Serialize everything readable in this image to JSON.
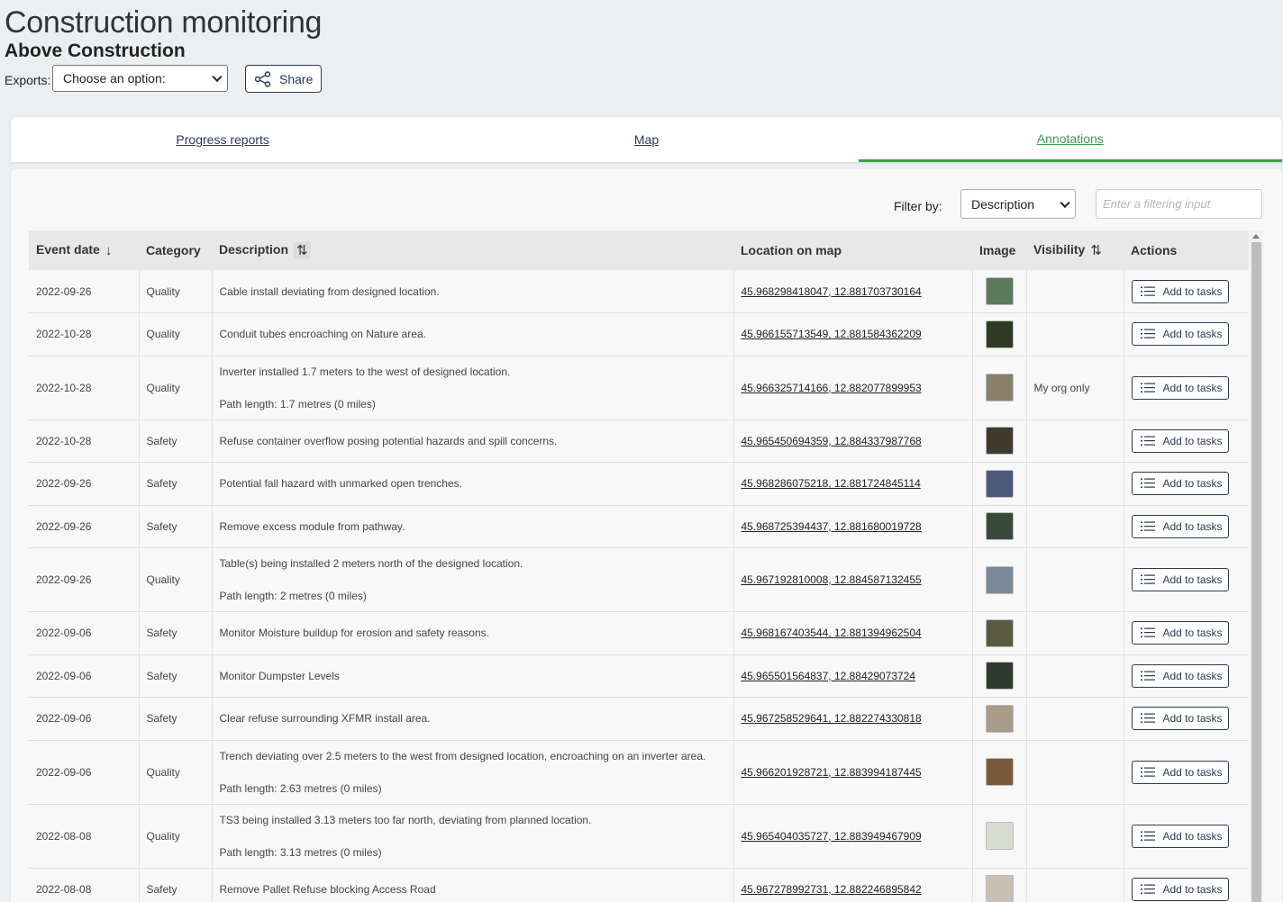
{
  "header": {
    "app_title": "Construction monitoring",
    "project_title": "Above Construction",
    "exports_label": "Exports:",
    "exports_selected": "Choose an option:",
    "share_label": "Share"
  },
  "tabs": [
    {
      "label": "Progress reports",
      "active": false
    },
    {
      "label": "Map",
      "active": false
    },
    {
      "label": "Annotations",
      "active": true
    }
  ],
  "filter": {
    "label": "Filter by:",
    "selected": "Description",
    "placeholder": "Enter a filtering input"
  },
  "table": {
    "columns": [
      "Event date",
      "Category",
      "Description",
      "Location on map",
      "Image",
      "Visibility",
      "Actions"
    ],
    "action_label": "Add to tasks",
    "rows": [
      {
        "date": "2022-09-26",
        "category": "Quality",
        "description": "Cable install deviating from designed location.",
        "path": "",
        "location": "45.968298418047, 12.881703730164",
        "visibility": "",
        "thumb_color": "#5a7a5a"
      },
      {
        "date": "2022-10-28",
        "category": "Quality",
        "description": "Conduit tubes encroaching on Nature area.",
        "path": "",
        "location": "45.966155713549, 12.881584362209",
        "visibility": "",
        "thumb_color": "#2e3a22"
      },
      {
        "date": "2022-10-28",
        "category": "Quality",
        "description": "Inverter installed 1.7 meters to the west of designed location.",
        "path": "Path length: 1.7 metres (0 miles)",
        "location": "45.966325714166, 12.882077899953",
        "visibility": "My org only",
        "thumb_color": "#8a7f6a"
      },
      {
        "date": "2022-10-28",
        "category": "Safety",
        "description": "Refuse container overflow posing potential hazards and spill concerns.",
        "path": "",
        "location": "45.965450694359, 12.884337987768",
        "visibility": "",
        "thumb_color": "#3e3a2c"
      },
      {
        "date": "2022-09-26",
        "category": "Safety",
        "description": "Potential fall hazard with unmarked open trenches.",
        "path": "",
        "location": "45.968286075218, 12.881724845114",
        "visibility": "",
        "thumb_color": "#4a5a7a"
      },
      {
        "date": "2022-09-26",
        "category": "Safety",
        "description": "Remove excess module from pathway.",
        "path": "",
        "location": "45.968725394437, 12.881680019728",
        "visibility": "",
        "thumb_color": "#3a4a3a"
      },
      {
        "date": "2022-09-26",
        "category": "Quality",
        "description": "Table(s) being installed 2 meters north of the designed location.",
        "path": "Path length: 2 metres (0 miles)",
        "location": "45.967192810008, 12.884587132455",
        "visibility": "",
        "thumb_color": "#7a8a9a"
      },
      {
        "date": "2022-09-06",
        "category": "Safety",
        "description": "Monitor Moisture buildup for erosion and safety reasons.",
        "path": "",
        "location": "45.968167403544, 12.881394962504",
        "visibility": "",
        "thumb_color": "#5a5a40"
      },
      {
        "date": "2022-09-06",
        "category": "Safety",
        "description": "Monitor Dumpster Levels",
        "path": "",
        "location": "45.965501564837, 12.88429073724",
        "visibility": "",
        "thumb_color": "#2e3a30"
      },
      {
        "date": "2022-09-06",
        "category": "Safety",
        "description": "Clear refuse surrounding XFMR install area.",
        "path": "",
        "location": "45.967258529641, 12.882274330818",
        "visibility": "",
        "thumb_color": "#a89c88"
      },
      {
        "date": "2022-09-06",
        "category": "Quality",
        "description": "Trench deviating over 2.5 meters to the west from designed location, encroaching on an inverter area.",
        "path": "Path length: 2.63 metres (0 miles)",
        "location": "45.966201928721, 12.883994187445",
        "visibility": "",
        "thumb_color": "#7a5a3a"
      },
      {
        "date": "2022-08-08",
        "category": "Quality",
        "description": "TS3 being installed 3.13 meters too far north, deviating from planned location.",
        "path": "Path length: 3.13 metres (0 miles)",
        "location": "45.965404035727, 12.883949467909",
        "visibility": "",
        "thumb_color": "#d8dcd0"
      },
      {
        "date": "2022-08-08",
        "category": "Safety",
        "description": "Remove Pallet Refuse blocking Access Road",
        "path": "",
        "location": "45.967278992731, 12.882246895842",
        "visibility": "",
        "thumb_color": "#c8c0b0"
      }
    ]
  }
}
